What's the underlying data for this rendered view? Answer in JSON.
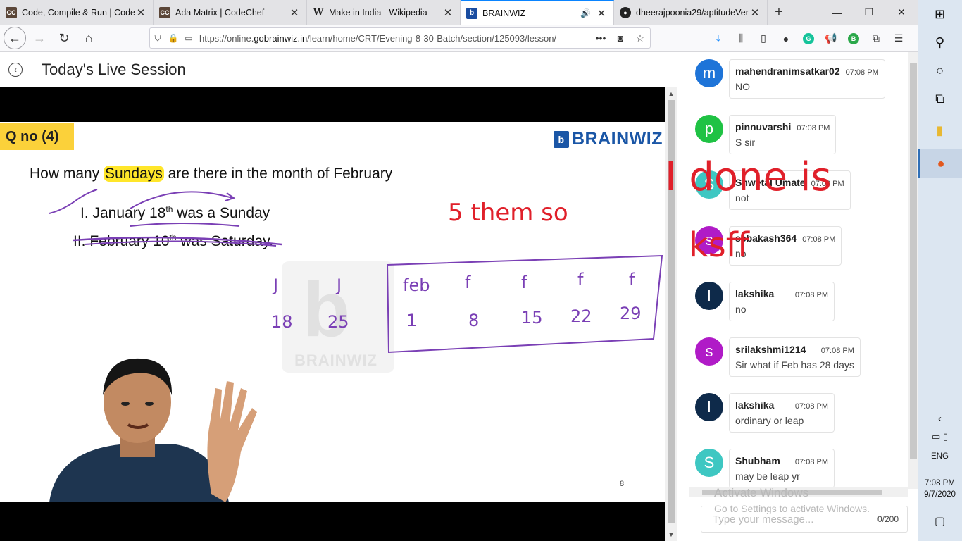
{
  "browser": {
    "tabs": [
      {
        "title": "Code, Compile & Run | CodeC",
        "favicon": "cc"
      },
      {
        "title": "Ada Matrix | CodeChef",
        "favicon": "cc"
      },
      {
        "title": "Make in India - Wikipedia",
        "favicon": "W"
      },
      {
        "title": "BRAINWIZ",
        "favicon": "b",
        "active": true,
        "playing_audio": true
      },
      {
        "title": "dheerajpoonia29/aptitudeVerb",
        "favicon": "gh"
      }
    ],
    "url": {
      "prefix": "https://online.",
      "domain": "gobrainwiz.in",
      "path": "/learn/home/CRT/Evening-8-30-Batch/section/125093/lesson/"
    },
    "more_glyph": "•••"
  },
  "page": {
    "title": "Today's Live Session"
  },
  "slide": {
    "tag": "Q no (4)",
    "brand": "BRAINWIZ",
    "brand_letter": "b",
    "question_pre": "How many ",
    "question_highlight": "Sundays",
    "question_post": " are there in the month of  February",
    "statement1": "I. January 18",
    "statement1_sup": "th",
    "statement1_end": " was a Sunday",
    "statement2": "II. February 10",
    "statement2_sup": "th",
    "statement2_end": " was Saturday.",
    "page_number": "8",
    "watermark_text": "BRAINWIZ",
    "watermark_letter": "b",
    "annotations": {
      "month_labels": [
        "J",
        "J",
        "feb",
        "f",
        "f",
        "f",
        "f"
      ],
      "dates": [
        "18",
        "25",
        "1",
        "8",
        "15",
        "22",
        "29"
      ],
      "red_text_1": "5 them so",
      "red_text_2": "I done is",
      "red_text_3": "ksff"
    }
  },
  "chat": {
    "messages": [
      {
        "initial": "m",
        "name": "mahendranimsatkar02",
        "time": "07:08 PM",
        "text": "NO",
        "color": "#1e74d8"
      },
      {
        "initial": "p",
        "name": "pinnuvarshi",
        "time": "07:08 PM",
        "text": "S sir",
        "color": "#1fc244"
      },
      {
        "initial": "S",
        "name": "Shwetal Umate",
        "time": "07:08 PM",
        "text": "not",
        "color": "#3ec7c2"
      },
      {
        "initial": "s",
        "name": "sebakash364",
        "time": "07:08 PM",
        "text": "no",
        "color": "#b01bc7"
      },
      {
        "initial": "l",
        "name": "lakshika",
        "time": "07:08 PM",
        "text": "no",
        "color": "#0e2a4a"
      },
      {
        "initial": "s",
        "name": "srilakshmi1214",
        "time": "07:08 PM",
        "text": "Sir what if Feb has 28 days",
        "color": "#b01bc7"
      },
      {
        "initial": "l",
        "name": "lakshika",
        "time": "07:08 PM",
        "text": "ordinary or leap",
        "color": "#0e2a4a"
      },
      {
        "initial": "S",
        "name": "Shubham",
        "time": "07:08 PM",
        "text": "may be leap yr",
        "color": "#3ec7c2"
      }
    ],
    "input_placeholder": "Type your message...",
    "counter": "0/200"
  },
  "overlay": {
    "activate_title": "Activate Windows",
    "activate_sub": "Go to Settings to activate Windows."
  },
  "taskbar": {
    "language": "ENG",
    "time": "7:08 PM",
    "date": "9/7/2020"
  }
}
